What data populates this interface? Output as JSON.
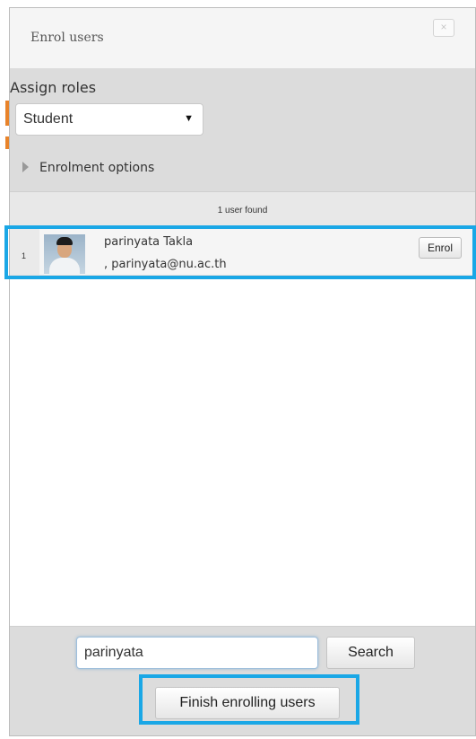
{
  "dialog": {
    "title": "Enrol users",
    "close_label": "×"
  },
  "options": {
    "assign_roles_label": "Assign roles",
    "role_selected": "Student",
    "enrolment_options_label": "Enrolment options"
  },
  "results": {
    "summary": "1 user found",
    "users": [
      {
        "index": "1",
        "name": "parinyata Takla",
        "email": ", parinyata@nu.ac.th",
        "action": "Enrol"
      }
    ]
  },
  "footer": {
    "search_value": "parinyata",
    "search_button": "Search",
    "finish_button": "Finish enrolling users"
  },
  "colors": {
    "highlight": "#1aa7e6",
    "panel_gray": "#dcdcdc",
    "edge_accent": "#e8832a"
  }
}
